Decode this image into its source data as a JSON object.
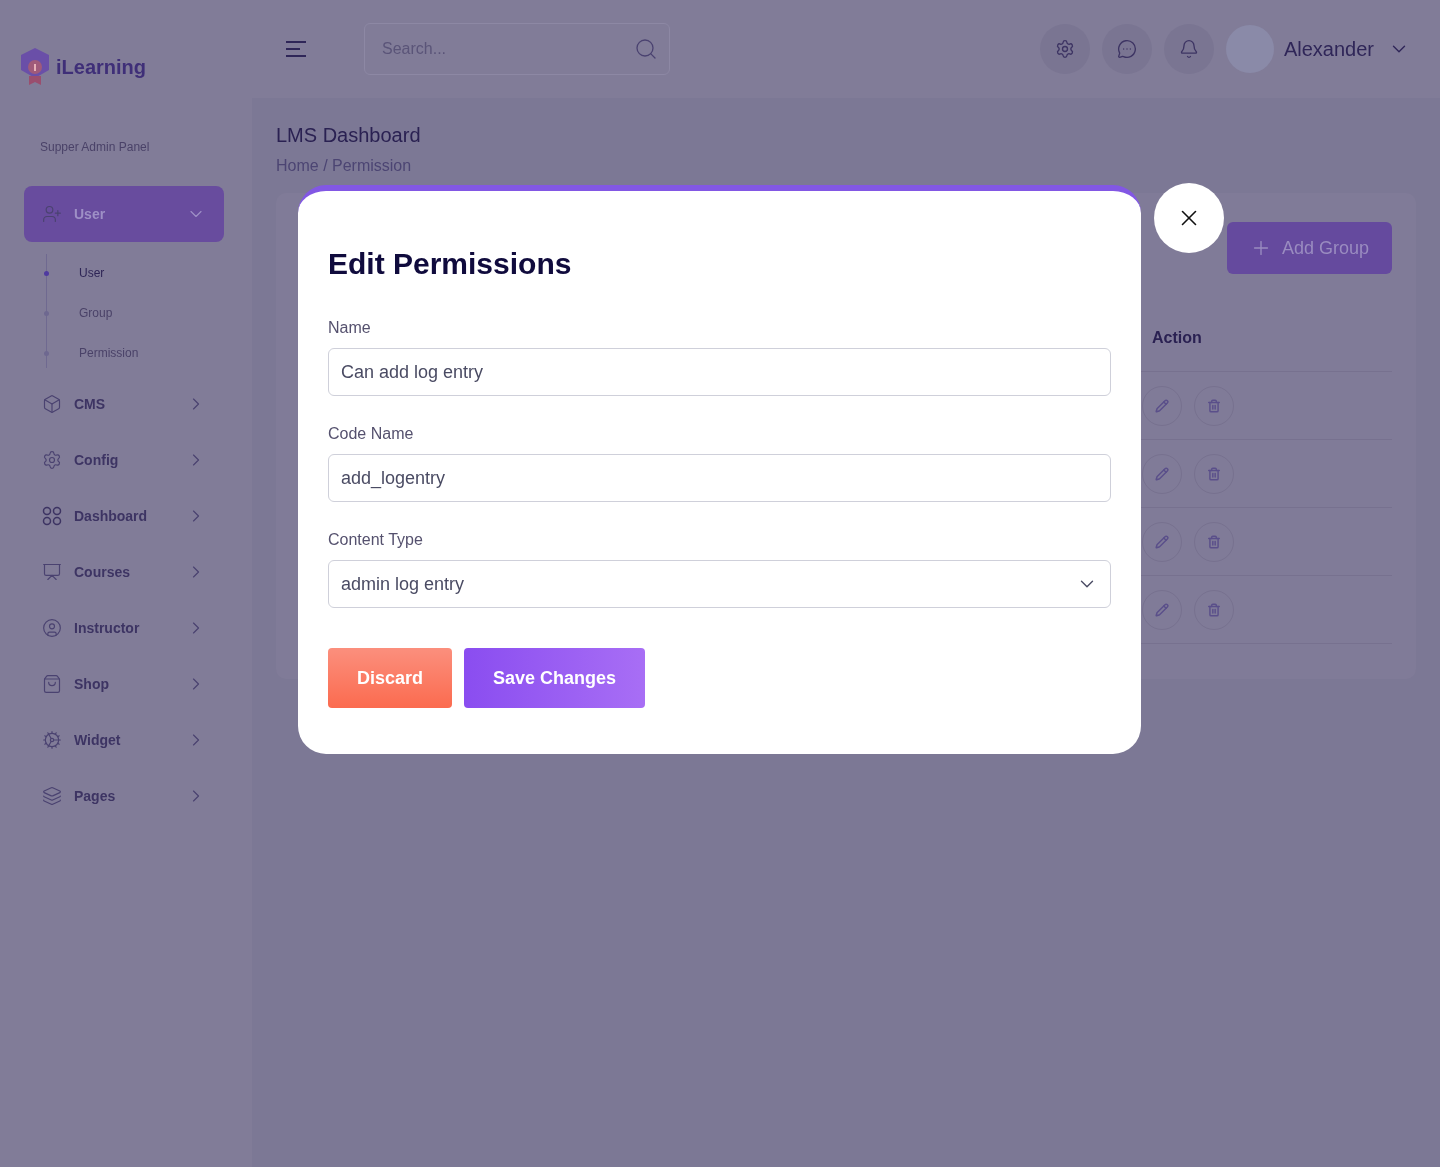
{
  "brand": {
    "name": "iLearning"
  },
  "header": {
    "search": {
      "placeholder": "Search..."
    },
    "user": {
      "name": "Alexander"
    }
  },
  "sidebar": {
    "panel_title": "Supper Admin Panel",
    "items": [
      {
        "label": "User",
        "kind": "user",
        "selected": true,
        "expanded": true,
        "children": [
          {
            "label": "User",
            "selected": true
          },
          {
            "label": "Group",
            "selected": false
          },
          {
            "label": "Permission",
            "selected": false
          }
        ]
      },
      {
        "label": "CMS",
        "kind": "cms",
        "selected": false,
        "expanded": false
      },
      {
        "label": "Config",
        "kind": "config",
        "selected": false,
        "expanded": false
      },
      {
        "label": "Dashboard",
        "kind": "dashboard",
        "selected": false,
        "expanded": false
      },
      {
        "label": "Courses",
        "kind": "courses",
        "selected": false,
        "expanded": false
      },
      {
        "label": "Instructor",
        "kind": "instructor",
        "selected": false,
        "expanded": false
      },
      {
        "label": "Shop",
        "kind": "shop",
        "selected": false,
        "expanded": false
      },
      {
        "label": "Widget",
        "kind": "widget",
        "selected": false,
        "expanded": false
      },
      {
        "label": "Pages",
        "kind": "pages",
        "selected": false,
        "expanded": false
      }
    ]
  },
  "page": {
    "title": "LMS Dashboard",
    "breadcrumb": "Home / Permission"
  },
  "card": {
    "add_button": "Add Group",
    "table": {
      "columns": [
        "Action"
      ],
      "rows": [
        {
          "kind": "edit-delete"
        },
        {
          "kind": "edit-delete"
        },
        {
          "kind": "edit-delete"
        },
        {
          "kind": "edit-delete"
        }
      ]
    }
  },
  "modal": {
    "title": "Edit Permissions",
    "fields": [
      {
        "label": "Name",
        "kind": "text",
        "value": "Can add log entry"
      },
      {
        "label": "Code Name",
        "kind": "text",
        "value": "add_logentry"
      },
      {
        "label": "Content Type",
        "kind": "select",
        "value": "admin log entry"
      }
    ],
    "buttons": [
      {
        "label": "Discard",
        "kind": "discard"
      },
      {
        "label": "Save Changes",
        "kind": "save"
      }
    ]
  }
}
